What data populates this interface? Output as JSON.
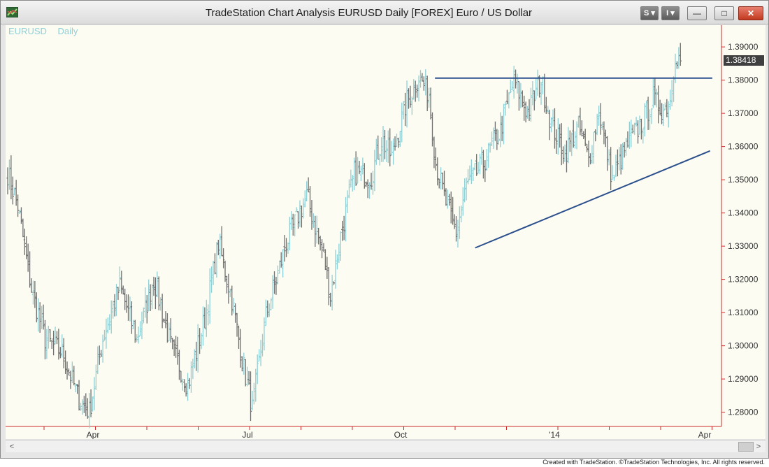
{
  "window": {
    "title": "TradeStation Chart Analysis    EURUSD Daily [FOREX] Euro / US Dollar",
    "app_icon": "tradestation-chart-icon",
    "buttons": {
      "s_menu": "S",
      "i_menu": "I",
      "minimize": "—",
      "maximize": "□",
      "close": "✕"
    }
  },
  "chart_header": {
    "symbol": "EURUSD",
    "interval": "Daily"
  },
  "last_price_tag": "1.38418",
  "credit": "Created with TradeStation. ©TradeStation Technologies, Inc. All rights reserved.",
  "colors": {
    "background": "#fcfcf3",
    "up_bar": "#8fd0d6",
    "down_bar": "#6e6e6e",
    "trendline": "#2b4f8c",
    "axis": "#cc2a2a"
  },
  "chart_data": {
    "type": "bar",
    "style": "OHLC",
    "symbol": "EURUSD",
    "interval": "Daily",
    "ylim": [
      1.2755,
      1.3955
    ],
    "y_ticks": [
      "1.39000",
      "1.38000",
      "1.37000",
      "1.36000",
      "1.35000",
      "1.34000",
      "1.33000",
      "1.32000",
      "1.31000",
      "1.30000",
      "1.29000",
      "1.28000"
    ],
    "x_ticks": [
      "Apr",
      "Jul",
      "Oct",
      "'14",
      "Apr"
    ],
    "bar_count": 250,
    "price_path": [
      {
        "i": 0,
        "p": 1.352
      },
      {
        "i": 6,
        "p": 1.342
      },
      {
        "i": 14,
        "p": 1.317
      },
      {
        "i": 22,
        "p": 1.302
      },
      {
        "i": 32,
        "p": 1.298
      },
      {
        "i": 42,
        "p": 1.284
      },
      {
        "i": 48,
        "p": 1.28
      },
      {
        "i": 56,
        "p": 1.302
      },
      {
        "i": 66,
        "p": 1.318
      },
      {
        "i": 76,
        "p": 1.302
      },
      {
        "i": 86,
        "p": 1.32
      },
      {
        "i": 96,
        "p": 1.3
      },
      {
        "i": 106,
        "p": 1.288
      },
      {
        "i": 116,
        "p": 1.308
      },
      {
        "i": 124,
        "p": 1.331
      },
      {
        "i": 132,
        "p": 1.314
      },
      {
        "i": 138,
        "p": 1.296
      },
      {
        "i": 144,
        "p": 1.281
      },
      {
        "i": 152,
        "p": 1.309
      },
      {
        "i": 164,
        "p": 1.331
      },
      {
        "i": 176,
        "p": 1.345
      },
      {
        "i": 186,
        "p": 1.327
      },
      {
        "i": 190,
        "p": 1.315
      },
      {
        "i": 196,
        "p": 1.333
      },
      {
        "i": 204,
        "p": 1.352
      },
      {
        "i": 214,
        "p": 1.351
      },
      {
        "i": 220,
        "p": 1.362
      },
      {
        "i": 226,
        "p": 1.357
      },
      {
        "i": 234,
        "p": 1.372
      },
      {
        "i": 242,
        "p": 1.381
      },
      {
        "i": 248,
        "p": 1.376
      },
      {
        "i": 252,
        "p": 1.355
      },
      {
        "i": 258,
        "p": 1.343
      },
      {
        "i": 264,
        "p": 1.334
      },
      {
        "i": 270,
        "p": 1.348
      },
      {
        "i": 280,
        "p": 1.355
      },
      {
        "i": 290,
        "p": 1.365
      },
      {
        "i": 298,
        "p": 1.38
      },
      {
        "i": 306,
        "p": 1.37
      },
      {
        "i": 314,
        "p": 1.38
      },
      {
        "i": 320,
        "p": 1.367
      },
      {
        "i": 328,
        "p": 1.358
      },
      {
        "i": 336,
        "p": 1.366
      },
      {
        "i": 342,
        "p": 1.356
      },
      {
        "i": 348,
        "p": 1.371
      },
      {
        "i": 356,
        "p": 1.35
      },
      {
        "i": 364,
        "p": 1.36
      },
      {
        "i": 372,
        "p": 1.366
      },
      {
        "i": 380,
        "p": 1.374
      },
      {
        "i": 386,
        "p": 1.371
      },
      {
        "i": 390,
        "p": 1.374
      },
      {
        "i": 393,
        "p": 1.388
      },
      {
        "i": 396,
        "p": 1.386
      }
    ],
    "lines": [
      {
        "name": "resistance",
        "x0": 0.565,
        "y0": 1.3806,
        "x1": 0.93,
        "y1": 1.3806
      },
      {
        "name": "support",
        "x0": 0.618,
        "y0": 1.3295,
        "x1": 0.927,
        "y1": 1.3587
      }
    ],
    "last": 1.38418
  }
}
